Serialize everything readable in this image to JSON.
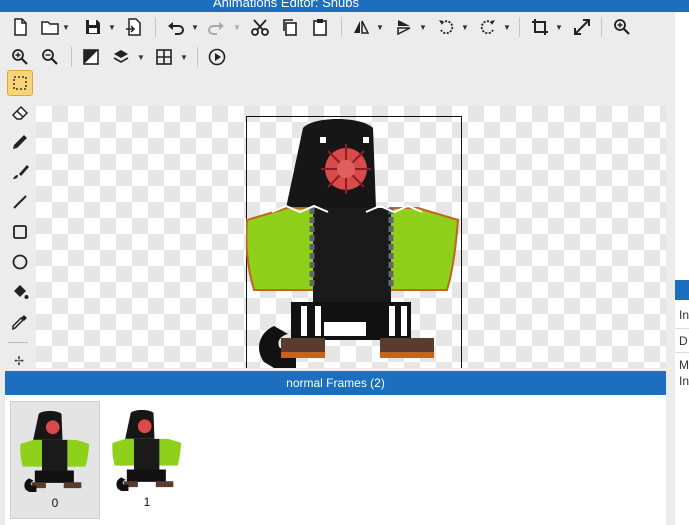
{
  "window": {
    "title": "Animations Editor: Snubs"
  },
  "toolbar": {
    "row1": [
      {
        "name": "new-file-icon"
      },
      {
        "name": "open-folder-icon",
        "caret": true
      },
      {
        "name": "save-icon",
        "caret": true
      },
      {
        "name": "export-icon"
      },
      {
        "name": "undo-icon",
        "caret": true
      },
      {
        "name": "redo-icon",
        "caret": true
      },
      {
        "name": "cut-icon"
      },
      {
        "name": "copy-icon"
      },
      {
        "name": "paste-icon"
      },
      {
        "name": "flip-horizontal-icon",
        "caret": true
      },
      {
        "name": "flip-vertical-icon",
        "caret": true
      },
      {
        "name": "rotate-left-icon",
        "caret": true
      },
      {
        "name": "rotate-right-icon",
        "caret": true
      },
      {
        "name": "crop-icon",
        "caret": true
      },
      {
        "name": "resize-icon"
      },
      {
        "name": "zoom-fit-icon"
      }
    ],
    "row2": [
      {
        "name": "zoom-in-icon"
      },
      {
        "name": "zoom-out-icon"
      },
      {
        "name": "invert-colors-icon"
      },
      {
        "name": "layers-icon",
        "caret": true
      },
      {
        "name": "grid-icon",
        "caret": true
      },
      {
        "name": "play-icon"
      }
    ]
  },
  "tools": [
    {
      "name": "select-tool-icon",
      "selected": true
    },
    {
      "name": "eraser-tool-icon"
    },
    {
      "name": "pencil-tool-icon"
    },
    {
      "name": "brush-tool-icon"
    },
    {
      "name": "line-tool-icon"
    },
    {
      "name": "rectangle-tool-icon"
    },
    {
      "name": "ellipse-tool-icon"
    },
    {
      "name": "fill-bucket-tool-icon"
    },
    {
      "name": "eyedropper-tool-icon"
    }
  ],
  "frames": {
    "header": "normal Frames (2)",
    "items": [
      {
        "label": "0",
        "selected": true
      },
      {
        "label": "1",
        "selected": false
      }
    ]
  },
  "side_panel": {
    "rows": [
      "In",
      "D",
      "M",
      "In"
    ]
  },
  "colors": {
    "accent": "#1c6fbf",
    "selected_tool": "#f7d478"
  }
}
